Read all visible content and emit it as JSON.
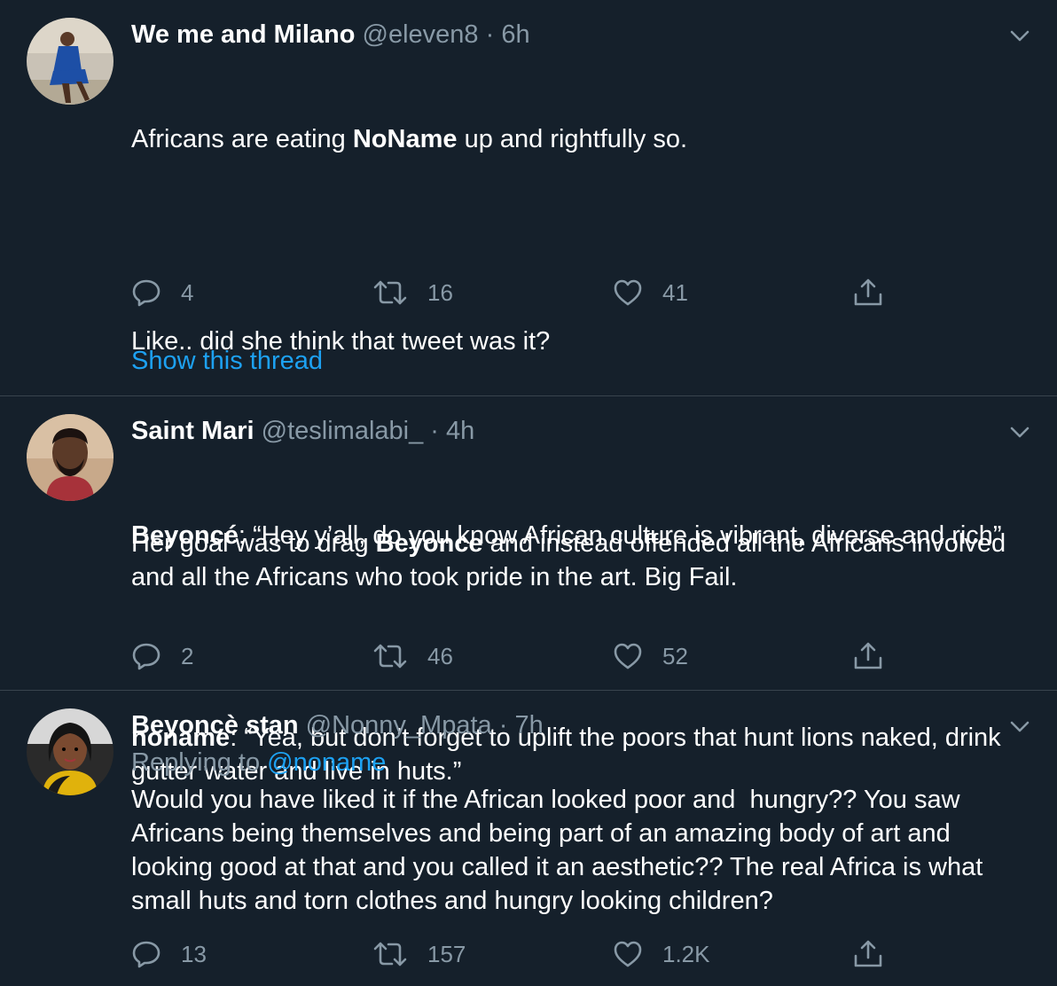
{
  "tweets": [
    {
      "name": "We me and Milano",
      "handle": "@eleven8",
      "sep": "·",
      "time": "6h",
      "para1_a": "Africans are eating ",
      "para1_b": "NoName",
      "para1_c": " up and rightfully so.",
      "para2": "Like.. did she think that tweet was it?",
      "para3_a": "Her goal was to drag ",
      "para3_b": "Beyonce",
      "para3_c": " and instead offended all the Africans involved and all the Africans who took pride in the art. Big Fail.",
      "replies": "4",
      "retweets": "16",
      "likes": "41",
      "show_thread": "Show this thread"
    },
    {
      "name": "Saint Mari",
      "handle": "@teslimalabi_",
      "sep": "·",
      "time": "4h",
      "para1_a": "Beyoncé",
      "para1_b": ": “Hey y’all, do you know African culture is vibrant, diverse and rich”",
      "para2_a": "noname",
      "para2_b": ": “Yea, but don’t forget to uplift the poors that hunt lions naked, drink gutter water and live in huts.”",
      "replies": "2",
      "retweets": "46",
      "likes": "52"
    },
    {
      "name": "Beyoncè stan",
      "handle": "@Nonny_Mpata",
      "sep": "·",
      "time": "7h",
      "replying_label": "Replying to ",
      "replying_to": "@noname",
      "text": "Would you have liked it if the African looked poor and  hungry?? You saw Africans being themselves and being part of an amazing body of art and looking good at that and you called it an aesthetic?? The real Africa is what small huts and torn clothes and hungry looking children?",
      "replies": "13",
      "retweets": "157",
      "likes": "1.2K"
    }
  ],
  "icons": {
    "reply": "reply-icon",
    "retweet": "retweet-icon",
    "like": "like-icon",
    "share": "share-icon",
    "more": "chevron-down-icon"
  },
  "colors": {
    "background": "#15202b",
    "text": "#ffffff",
    "muted": "#8899a6",
    "accent": "#1da1f2",
    "divider": "#38444d"
  }
}
